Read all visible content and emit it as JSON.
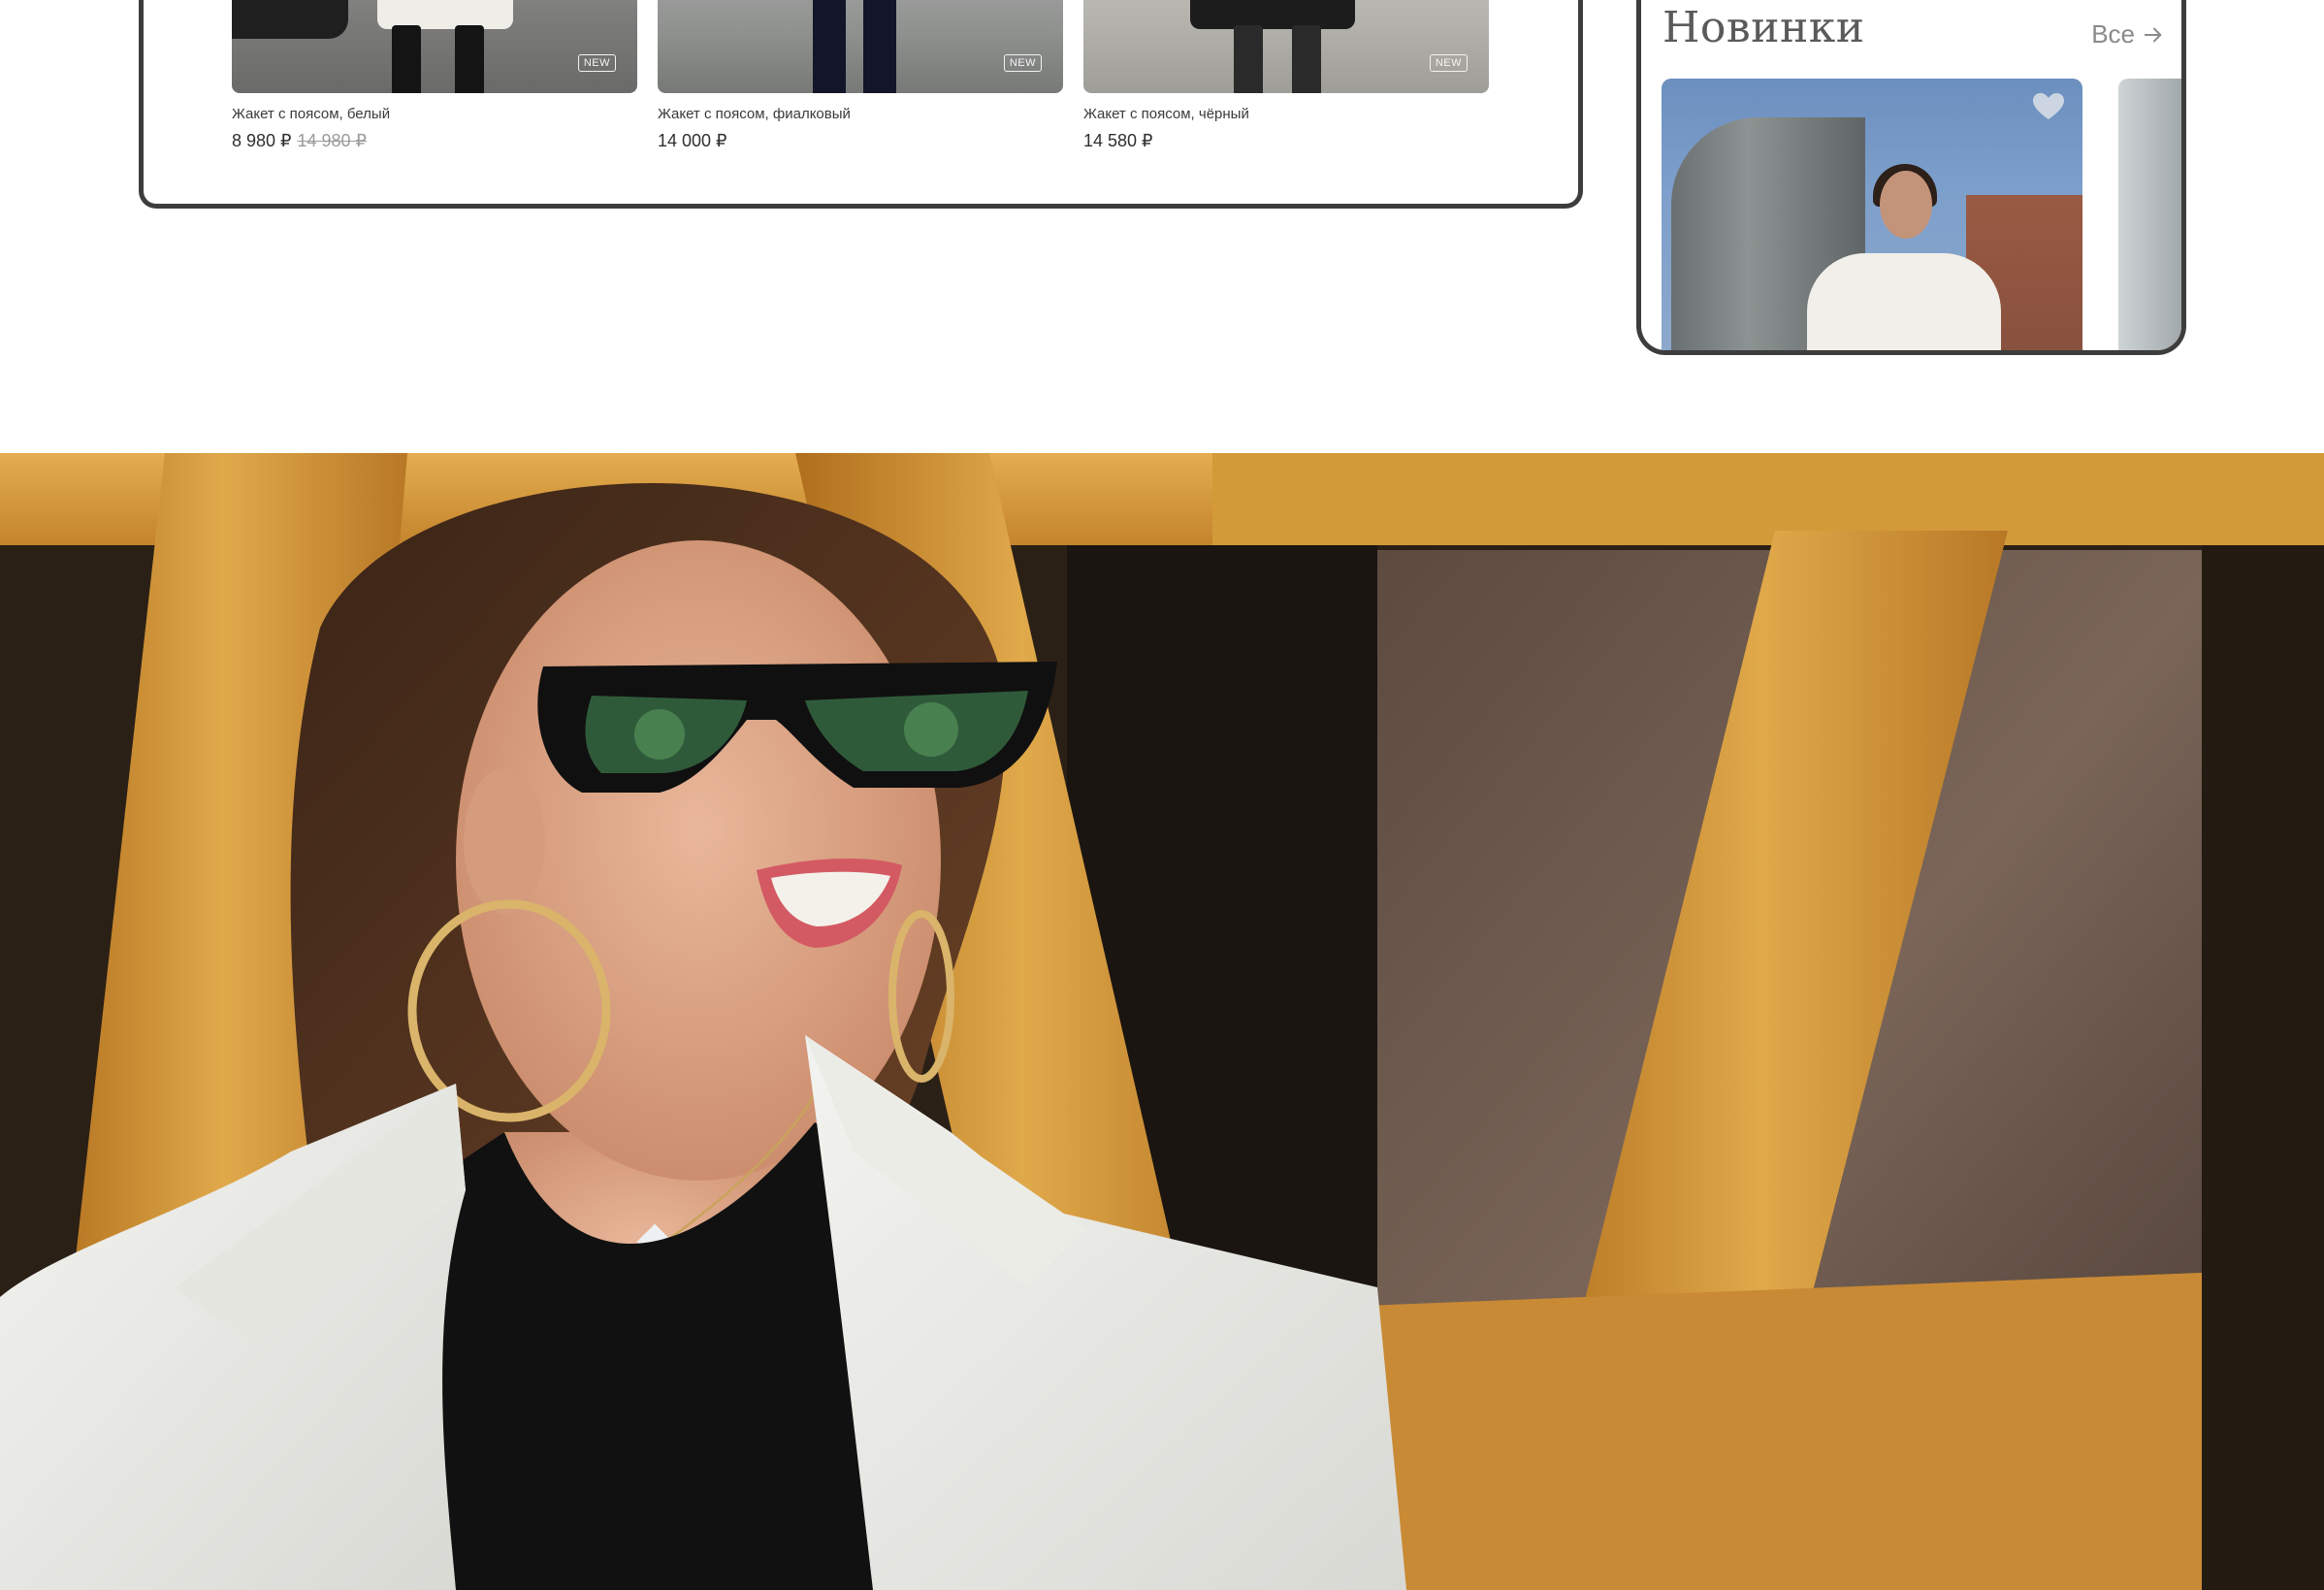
{
  "catalog": {
    "products": [
      {
        "name": "Жакет с поясом, белый",
        "price": "8 980 ₽",
        "old_price": "14 980 ₽",
        "badge": "NEW"
      },
      {
        "name": "Жакет с поясом, фиалковый",
        "price": "14 000 ₽",
        "old_price": "",
        "badge": "NEW"
      },
      {
        "name": "Жакет с поясом, чёрный",
        "price": "14 580 ₽",
        "old_price": "",
        "badge": "NEW"
      }
    ]
  },
  "mobile": {
    "section_title": "Новинки",
    "all_link": "Все",
    "arrow_icon": "arrow-right-icon",
    "favorite_icon": "heart-icon"
  },
  "hero": {
    "image_description_icon": "hero-photo"
  },
  "colors": {
    "frame_border": "#3d3d3d",
    "text_primary": "#2b2b2b",
    "text_muted": "#9b9b9b",
    "hero_wood": "#d39a3a"
  }
}
